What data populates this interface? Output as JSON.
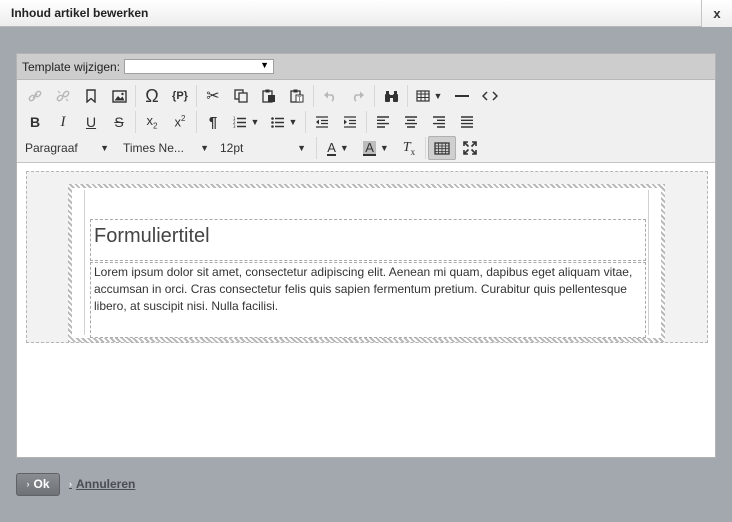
{
  "dialog": {
    "title": "Inhoud artikel bewerken",
    "close_label": "x"
  },
  "template": {
    "label": "Template wijzigen:",
    "selected": ""
  },
  "toolbar": {
    "row1": [
      {
        "icon": "link-icon",
        "glyph": "🔗",
        "disabled": true
      },
      {
        "icon": "unlink-icon",
        "glyph": "⛓",
        "disabled": true
      },
      {
        "icon": "bookmark-icon",
        "glyph": "🔖",
        "disabled": false
      },
      {
        "icon": "image-icon",
        "glyph": "▣",
        "disabled": false
      },
      {
        "icon": "special-char-icon",
        "glyph": "Ω",
        "disabled": false
      },
      {
        "icon": "placeholder-icon",
        "glyph": "{P}",
        "disabled": false
      },
      {
        "icon": "cut-icon",
        "glyph": "✂",
        "disabled": false
      },
      {
        "icon": "copy-icon",
        "glyph": "⎘",
        "disabled": false
      },
      {
        "icon": "paste-icon",
        "glyph": "📋",
        "disabled": false
      },
      {
        "icon": "paste-text-icon",
        "glyph": "📋",
        "disabled": false
      },
      {
        "icon": "undo-icon",
        "glyph": "↶",
        "disabled": true
      },
      {
        "icon": "redo-icon",
        "glyph": "↷",
        "disabled": true
      },
      {
        "icon": "find-icon",
        "glyph": "⌕",
        "disabled": false
      },
      {
        "icon": "table-icon",
        "glyph": "▦",
        "disabled": false
      },
      {
        "icon": "horizontal-rule-icon",
        "glyph": "—",
        "disabled": false
      },
      {
        "icon": "source-code-icon",
        "glyph": "<>",
        "disabled": false
      }
    ],
    "row2": [
      {
        "icon": "bold-icon",
        "glyph": "B"
      },
      {
        "icon": "italic-icon",
        "glyph": "I"
      },
      {
        "icon": "underline-icon",
        "glyph": "U"
      },
      {
        "icon": "strikethrough-icon",
        "glyph": "S"
      },
      {
        "icon": "subscript-icon",
        "glyph": "x₂"
      },
      {
        "icon": "superscript-icon",
        "glyph": "x²"
      },
      {
        "icon": "pilcrow-icon",
        "glyph": "¶"
      },
      {
        "icon": "numbered-list-icon",
        "glyph": "⒈"
      },
      {
        "icon": "bullet-list-icon",
        "glyph": "☰"
      },
      {
        "icon": "outdent-icon",
        "glyph": "⇤"
      },
      {
        "icon": "indent-icon",
        "glyph": "⇥"
      },
      {
        "icon": "align-left-icon",
        "glyph": "≡"
      },
      {
        "icon": "align-center-icon",
        "glyph": "≡"
      },
      {
        "icon": "align-right-icon",
        "glyph": "≡"
      },
      {
        "icon": "align-justify-icon",
        "glyph": "≡"
      }
    ],
    "format_label": "Paragraaf",
    "font_label": "Times Ne...",
    "size_label": "12pt",
    "text_color_glyph": "A",
    "bg_color_glyph": "A",
    "clear_format_glyph": "Tx",
    "colors": {
      "toolbar_bg": "#f0f0f0",
      "active_bg": "#cfcfcf",
      "disabled": "#b7b7b7"
    }
  },
  "content": {
    "heading": "Formuliertitel",
    "paragraph": "Lorem ipsum dolor sit amet, consectetur adipiscing elit. Aenean mi quam, dapibus eget aliquam vitae, accumsan in orci. Cras consectetur felis quis sapien fermentum pretium. Curabitur quis pellentesque libero, at suscipit nisi. Nulla facilisi."
  },
  "footer": {
    "ok_label": "Ok",
    "cancel_label": "Annuleren"
  }
}
